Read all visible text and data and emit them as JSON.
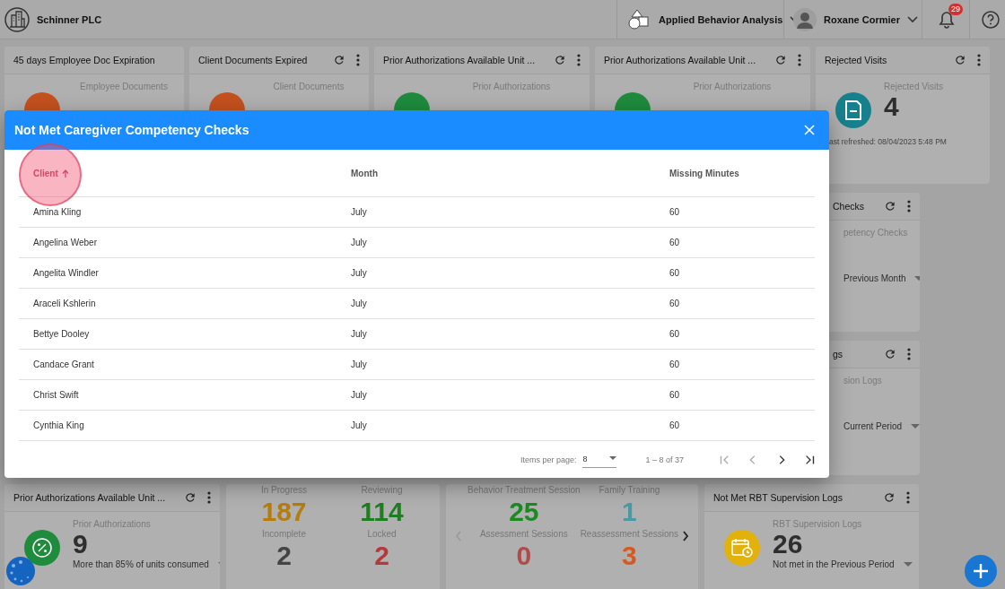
{
  "topbar": {
    "org_name": "Schinner PLC",
    "program": "Applied Behavior Analysis",
    "user": "Roxane Cormier",
    "notification_count": "29"
  },
  "top_cards": [
    {
      "title": "45 days Employee Doc Expiration",
      "label": "Employee Documents",
      "color": "#c4511e"
    },
    {
      "title": "Client Documents Expired",
      "label": "Client Documents",
      "color": "#c4511e"
    },
    {
      "title": "Prior Authorizations Available Unit ...",
      "label": "Prior Authorizations",
      "color": "#1f8b3d"
    },
    {
      "title": "Prior Authorizations Available Unit ...",
      "label": "Prior Authorizations",
      "color": "#1f8b3d"
    },
    {
      "title": "Rejected Visits",
      "label": "Rejected Visits",
      "value": "4",
      "footer": "ast refreshed: 08/04/2023 5:48 PM",
      "color": "#16808c"
    }
  ],
  "side_cards": [
    {
      "title": "Checks",
      "label": "petency Checks",
      "period": "Previous Month"
    },
    {
      "title": "gs",
      "label": "sion Logs",
      "period": "Current Period"
    }
  ],
  "prior_card": {
    "title": "Prior Authorizations Available Unit ...",
    "label": "Prior Authorizations",
    "value": "9",
    "period": "More than 85% of units consumed",
    "color": "#1f8b3d"
  },
  "status_stats": [
    {
      "label": "In Progress",
      "value": "187",
      "color": "#b57c0e"
    },
    {
      "label": "Reviewing",
      "value": "114",
      "color": "#1f7d22"
    },
    {
      "label": "Incomplete",
      "value": "2",
      "color": "#444444"
    },
    {
      "label": "Locked",
      "value": "2",
      "color": "#b23a3a"
    }
  ],
  "session_stats": [
    {
      "label": "Behavior Treatment Session",
      "value": "25",
      "color": "#1b8a22"
    },
    {
      "label": "Family Training",
      "value": "1",
      "color": "#4a9aa3"
    },
    {
      "label": "Assessment Sessions",
      "value": "0",
      "color": "#b24a4a"
    },
    {
      "label": "Reassessment Sessions",
      "value": "3",
      "color": "#d45a22"
    }
  ],
  "rbt_card": {
    "title": "Not Met RBT Supervision Logs",
    "label": "RBT Supervision Logs",
    "value": "26",
    "period": "Not met in the Previous Period",
    "color": "#e2b20a"
  },
  "dialog": {
    "title": "Not Met Caregiver Competency Checks",
    "columns": [
      {
        "label": "Client",
        "sorted": true
      },
      {
        "label": "Month",
        "sorted": false
      },
      {
        "label": "Missing Minutes",
        "sorted": false
      }
    ],
    "rows": [
      [
        "Amina Kling",
        "July",
        "60"
      ],
      [
        "Angelina Weber",
        "July",
        "60"
      ],
      [
        "Angelita Windler",
        "July",
        "60"
      ],
      [
        "Araceli Kshlerin",
        "July",
        "60"
      ],
      [
        "Bettye Dooley",
        "July",
        "60"
      ],
      [
        "Candace Grant",
        "July",
        "60"
      ],
      [
        "Christ Swift",
        "July",
        "60"
      ],
      [
        "Cynthia King",
        "July",
        "60"
      ]
    ],
    "paginator": {
      "items_label": "Items per page:",
      "page_size": "8",
      "range": "1 – 8 of 37",
      "nav": [
        {
          "kind": "first",
          "disabled": true
        },
        {
          "kind": "prev",
          "disabled": true
        },
        {
          "kind": "next",
          "disabled": false
        },
        {
          "kind": "last",
          "disabled": false
        }
      ]
    }
  }
}
